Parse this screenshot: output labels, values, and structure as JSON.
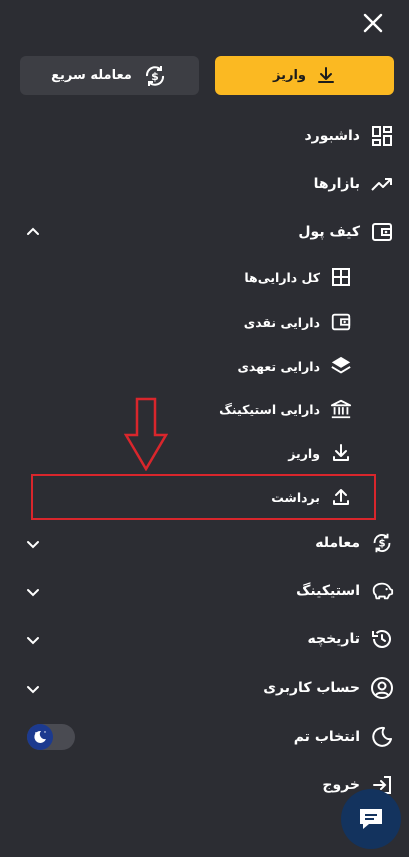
{
  "header": {
    "close_icon": "close-icon"
  },
  "actions": {
    "deposit_label": "واریز",
    "quick_trade_label": "معامله سریع",
    "accent_color": "#fbb922"
  },
  "menu": {
    "dashboard": "داشبورد",
    "markets": "بازارها",
    "wallet": "کیف پول",
    "wallet_sub": {
      "all_assets": "کل دارایی‌ها",
      "cash_asset": "دارایی نقدی",
      "collateral_asset": "دارایی تعهدی",
      "staking_asset": "دارایی استیکینگ",
      "deposit": "واریز",
      "withdraw": "برداشت"
    },
    "trade": "معامله",
    "staking": "استیکینگ",
    "history": "تاریخچه",
    "account": "حساب کاربری",
    "theme": "انتخاب تم",
    "logout": "خروج"
  },
  "annotation_color": "#d9262c"
}
